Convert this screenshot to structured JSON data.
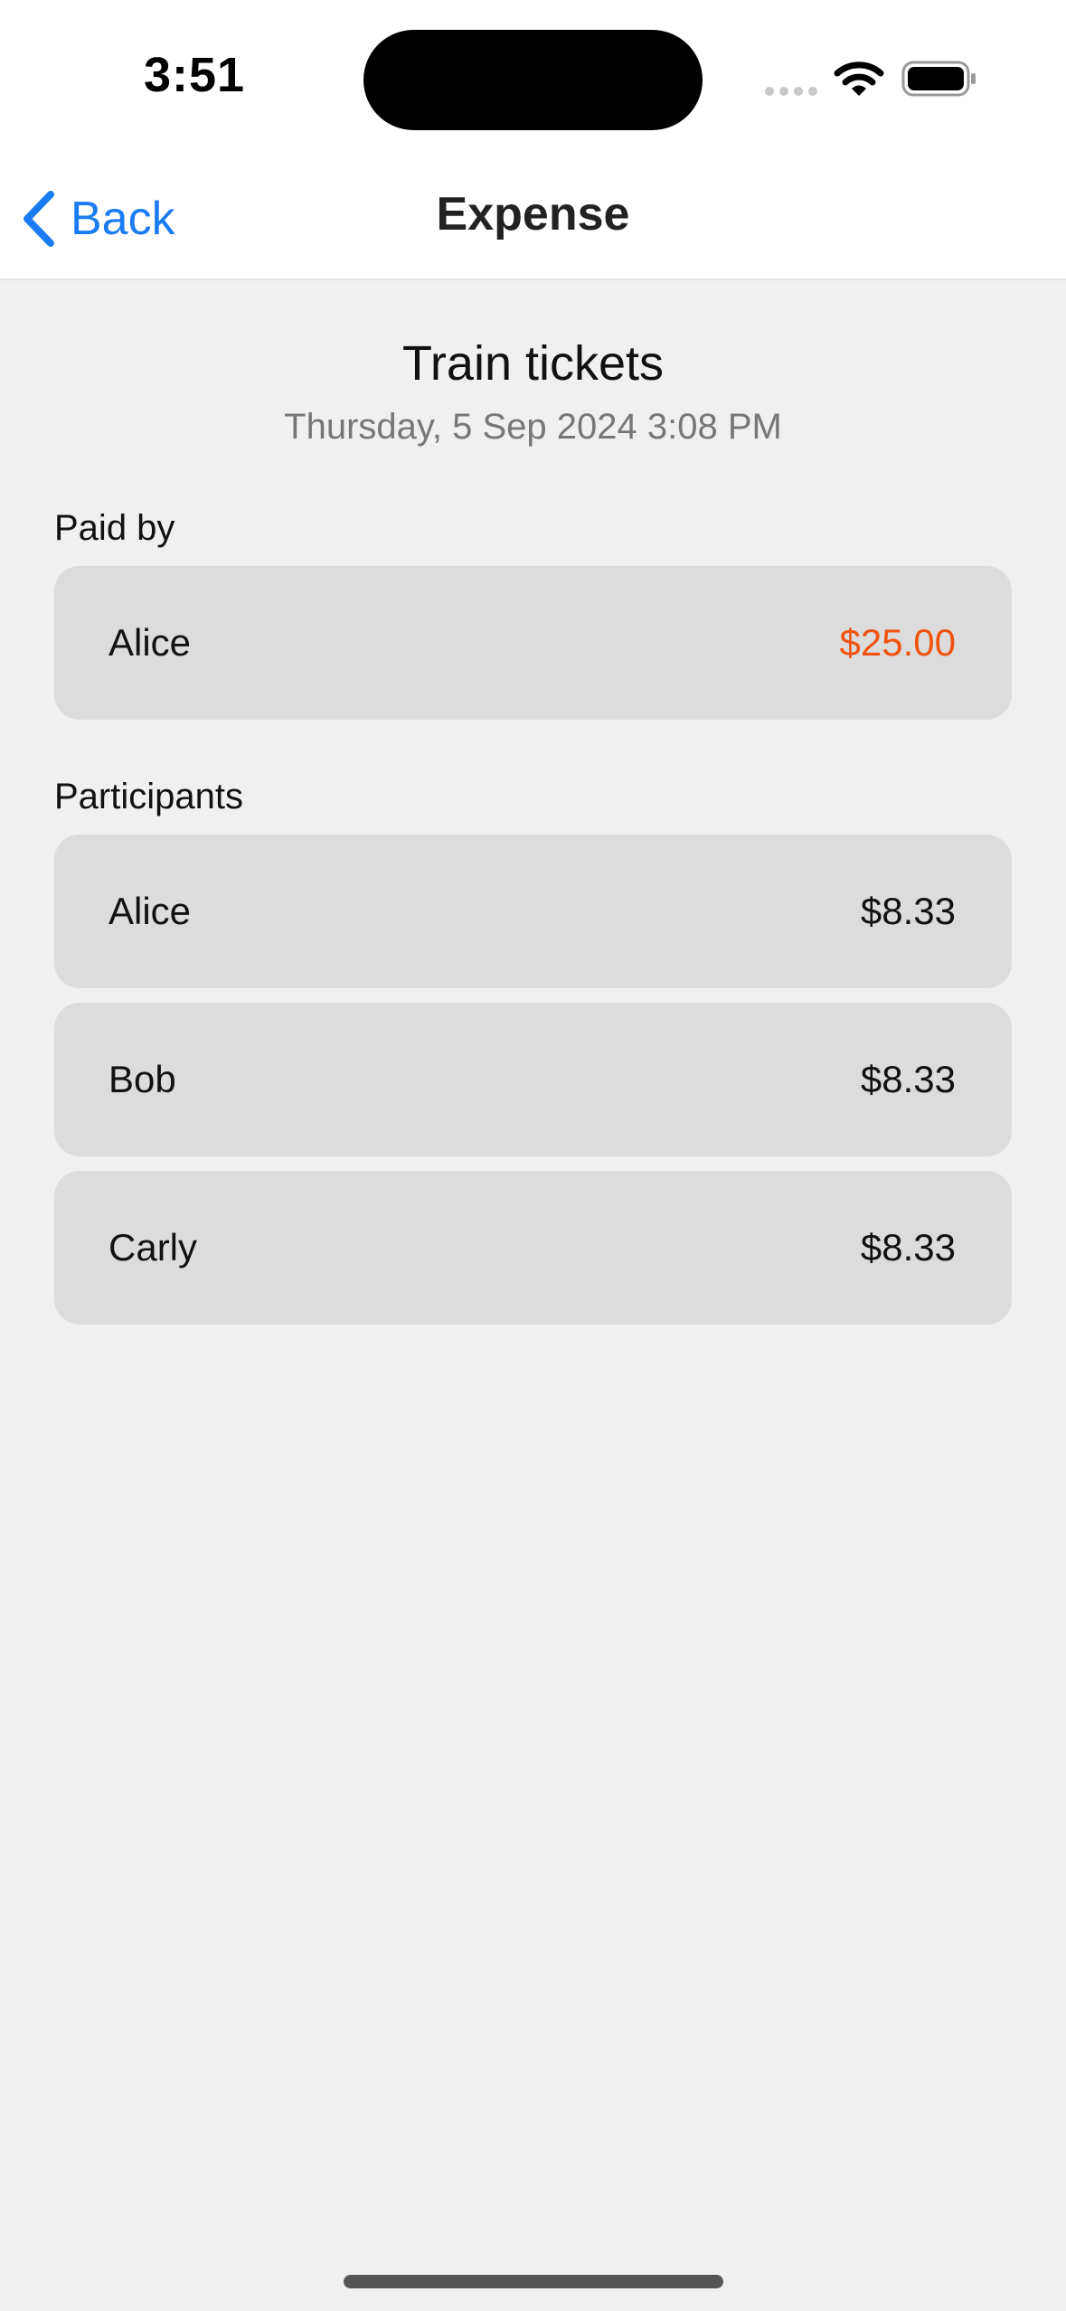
{
  "status_bar": {
    "time": "3:51"
  },
  "nav": {
    "back_label": "Back",
    "title": "Expense"
  },
  "expense": {
    "title": "Train tickets",
    "date": "Thursday, 5 Sep 2024 3:08 PM"
  },
  "paid_by": {
    "label": "Paid by",
    "name": "Alice",
    "amount": "$25.00"
  },
  "participants": {
    "label": "Participants",
    "items": [
      {
        "name": "Alice",
        "amount": "$8.33"
      },
      {
        "name": "Bob",
        "amount": "$8.33"
      },
      {
        "name": "Carly",
        "amount": "$8.33"
      }
    ]
  },
  "colors": {
    "accent": "#1a7cf2",
    "paid_amount": "#f0530f",
    "card_background": "#dcdcdc",
    "page_background": "#f0f0f0"
  },
  "icons": {
    "back": "chevron-left-icon",
    "signal": "cellular-signal-icon",
    "wifi": "wifi-icon",
    "battery": "battery-icon"
  }
}
